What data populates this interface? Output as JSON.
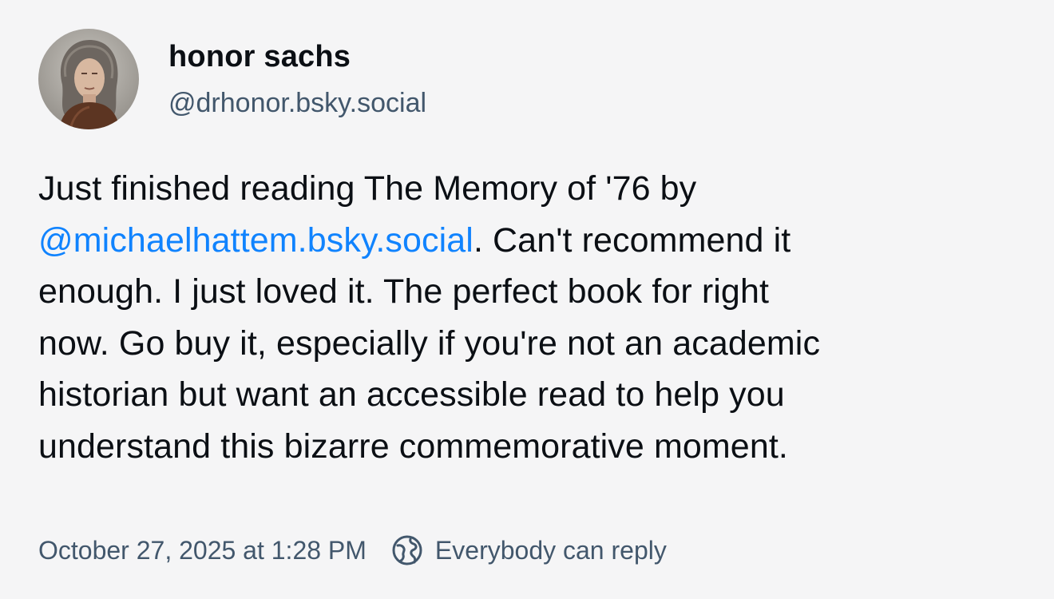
{
  "author": {
    "display_name": "honor sachs",
    "handle": "@drhonor.bsky.social",
    "avatar_icon": "profile-photo"
  },
  "post": {
    "line1": "Just finished reading The Memory of '76 by",
    "mention": "@michaelhattem.bsky.social",
    "line2_rest": ". Can't recommend it",
    "line3": "enough. I just loved it. The perfect book for right",
    "line4": "now. Go buy it, especially if you're not an academic",
    "line5": "historian but want an accessible read to help you",
    "line6": "understand this bizarre commemorative moment."
  },
  "meta": {
    "timestamp": "October 27, 2025 at 1:28 PM",
    "reply_setting_icon": "globe-icon",
    "reply_setting": "Everybody can reply"
  },
  "colors": {
    "background": "#f5f5f6",
    "mention": "#1083fe",
    "secondary_text": "#42576c"
  }
}
